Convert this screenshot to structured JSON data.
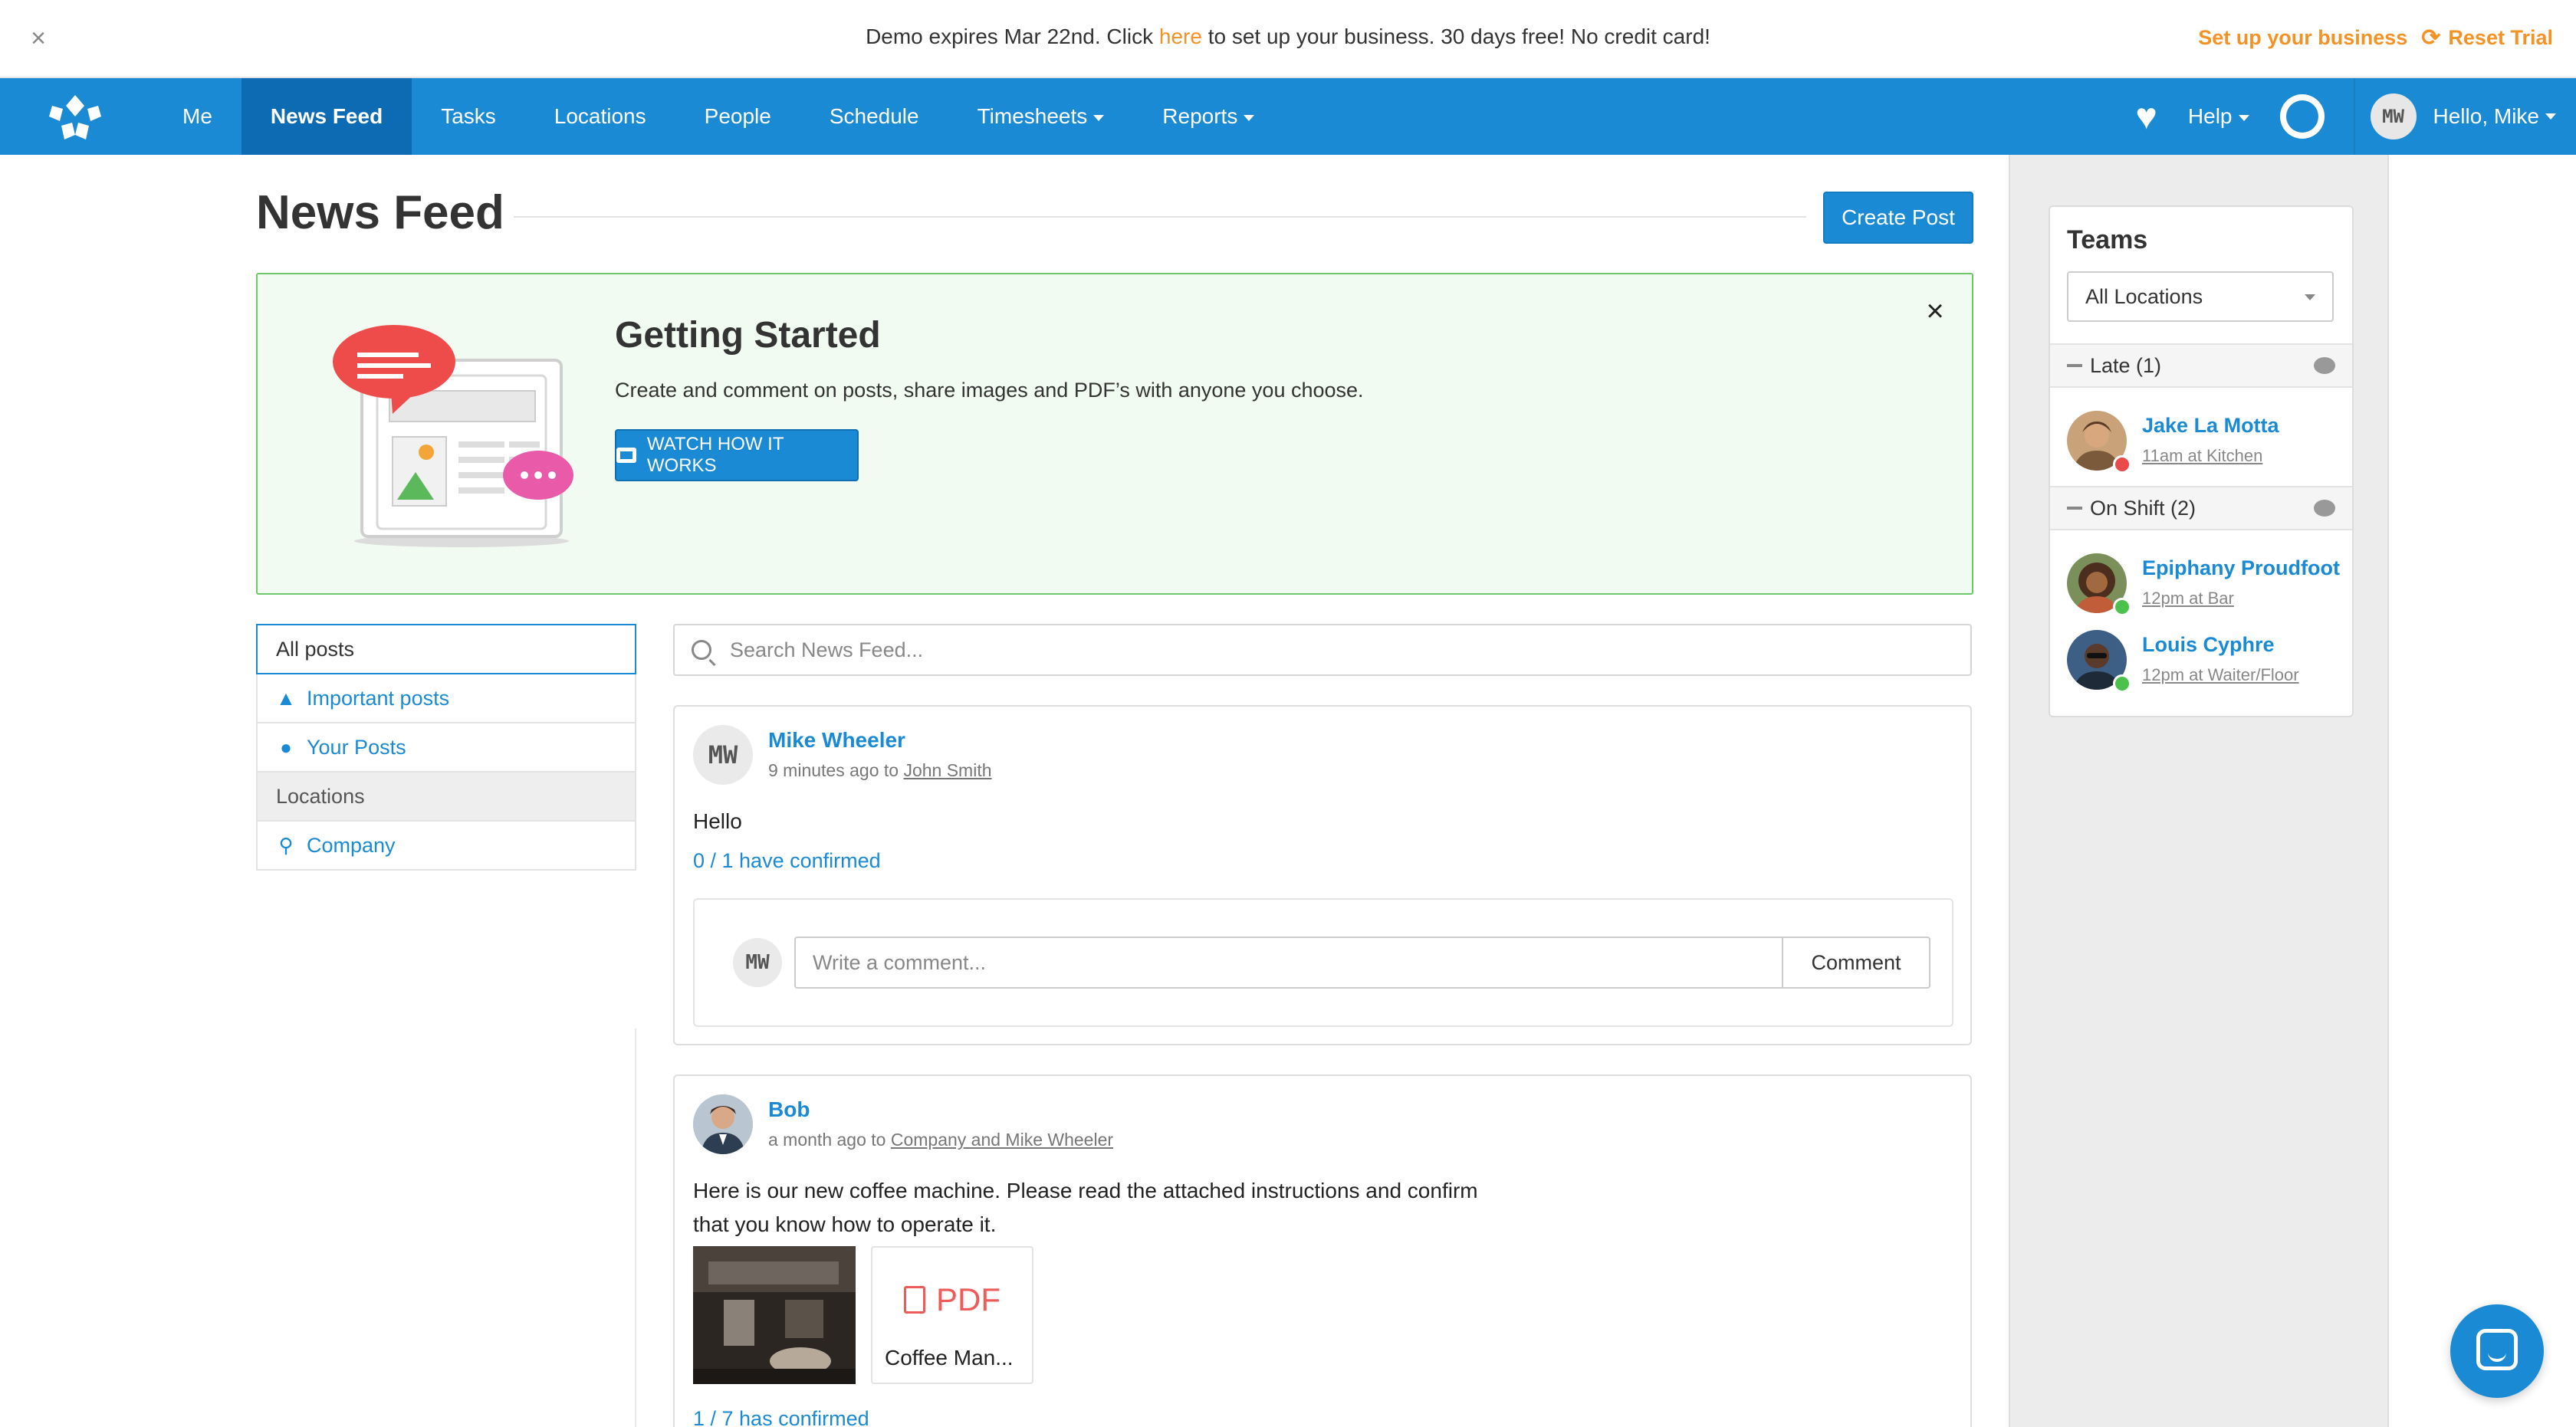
{
  "banner": {
    "text_before": "Demo expires Mar 22nd. Click ",
    "link": "here",
    "text_after": " to set up your business. 30 days free! No credit card!",
    "setup": "Set up your business",
    "reset": "Reset Trial",
    "close_icon": "close-icon"
  },
  "nav": {
    "items": [
      "Me",
      "News Feed",
      "Tasks",
      "Locations",
      "People",
      "Schedule",
      "Timesheets",
      "Reports"
    ],
    "active": "News Feed",
    "help": "Help",
    "user_initials": "MW",
    "greeting": "Hello, Mike"
  },
  "page": {
    "title": "News Feed",
    "create_post": "Create Post"
  },
  "getting_started": {
    "title": "Getting Started",
    "description": "Create and comment on posts, share images and PDF’s with anyone you choose.",
    "button": "WATCH HOW IT WORKS"
  },
  "filters": {
    "all_posts": "All posts",
    "important": "Important posts",
    "your_posts": "Your Posts",
    "locations_header": "Locations",
    "company": "Company"
  },
  "search": {
    "placeholder": "Search News Feed..."
  },
  "posts": [
    {
      "initials": "MW",
      "author": "Mike Wheeler",
      "meta_prefix": "9 minutes ago to ",
      "recipient": "John Smith",
      "body": "Hello",
      "confirmed": "0 / 1 have confirmed",
      "comment_initials": "MW",
      "comment_placeholder": "Write a comment...",
      "comment_button": "Comment"
    },
    {
      "author": "Bob",
      "meta_prefix": "a month ago to ",
      "recipient": "Company and Mike Wheeler",
      "body_line1": "Here is our new coffee machine. Please read the attached instructions and confirm",
      "body_line2": "that you know how to operate it.",
      "pdf_label": "PDF",
      "pdf_name": "Coffee Man...",
      "confirmed": "1 / 7 has confirmed"
    }
  ],
  "teams": {
    "title": "Teams",
    "select_value": "All Locations",
    "late_header": "Late (1)",
    "late": [
      {
        "name": "Jake La Motta",
        "shift": "11am at Kitchen",
        "status_color": "#e94a4a"
      }
    ],
    "on_shift_header": "On Shift (2)",
    "on_shift": [
      {
        "name": "Epiphany Proudfoot",
        "shift": "12pm at Bar",
        "status_color": "#4cc14c"
      },
      {
        "name": "Louis Cyphre",
        "shift": "12pm at Waiter/Floor",
        "status_color": "#4cc14c"
      }
    ]
  },
  "colors": {
    "brand": "#1a8ad4",
    "accent_orange": "#f39225",
    "success_green": "#6cc86a"
  }
}
